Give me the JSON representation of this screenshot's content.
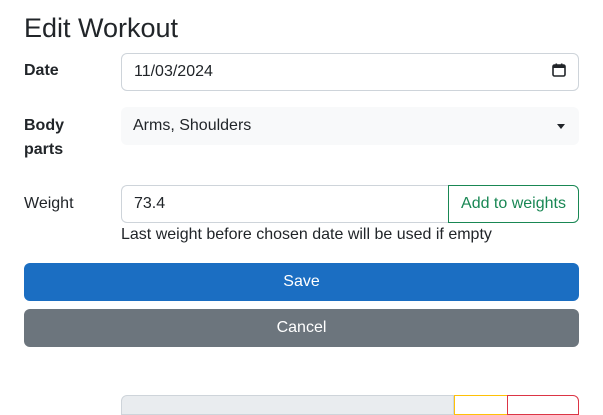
{
  "page": {
    "title": "Edit Workout"
  },
  "form": {
    "date": {
      "label": "Date",
      "value": "11/03/2024",
      "icon": "calendar-icon"
    },
    "body_parts": {
      "label_line1": "Body",
      "label_line2": "parts",
      "value": "Arms, Shoulders",
      "icon": "chevron-down-icon"
    },
    "weight": {
      "label": "Weight",
      "value": "73.4",
      "add_button": "Add to weights",
      "help": "Last weight before chosen date will be used if empty"
    }
  },
  "actions": {
    "save": "Save",
    "cancel": "Cancel"
  },
  "colors": {
    "primary": "#1b6ec2",
    "secondary": "#6c757d",
    "success": "#198754",
    "warning": "#ffc107",
    "danger": "#dc3545"
  }
}
